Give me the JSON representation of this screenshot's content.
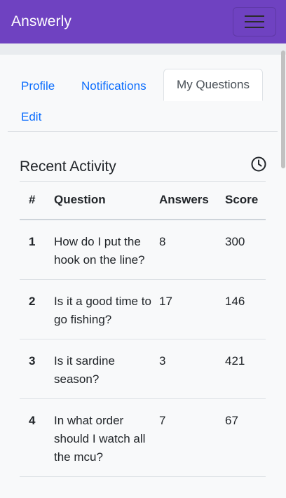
{
  "navbar": {
    "brand": "Answerly",
    "menu_icon": "hamburger-menu-icon",
    "background_color": "#6f42c1"
  },
  "tabs": [
    {
      "label": "Profile",
      "active": false
    },
    {
      "label": "Notifications",
      "active": false
    },
    {
      "label": "My Questions",
      "active": true
    },
    {
      "label": "Edit",
      "active": false
    }
  ],
  "section": {
    "title": "Recent Activity",
    "icon": "clock-icon"
  },
  "table": {
    "headers": [
      "#",
      "Question",
      "Answers",
      "Score"
    ],
    "rows": [
      {
        "num": "1",
        "question": "How do I put the hook on the line?",
        "answers": "8",
        "score": "300"
      },
      {
        "num": "2",
        "question": "Is it a good time to go fishing?",
        "answers": "17",
        "score": "146"
      },
      {
        "num": "3",
        "question": "Is it sardine season?",
        "answers": "3",
        "score": "421"
      },
      {
        "num": "4",
        "question": "In what order should I watch all the mcu?",
        "answers": "7",
        "score": "67"
      }
    ]
  },
  "colors": {
    "accent": "#6f42c1",
    "link": "#0d6efd"
  }
}
